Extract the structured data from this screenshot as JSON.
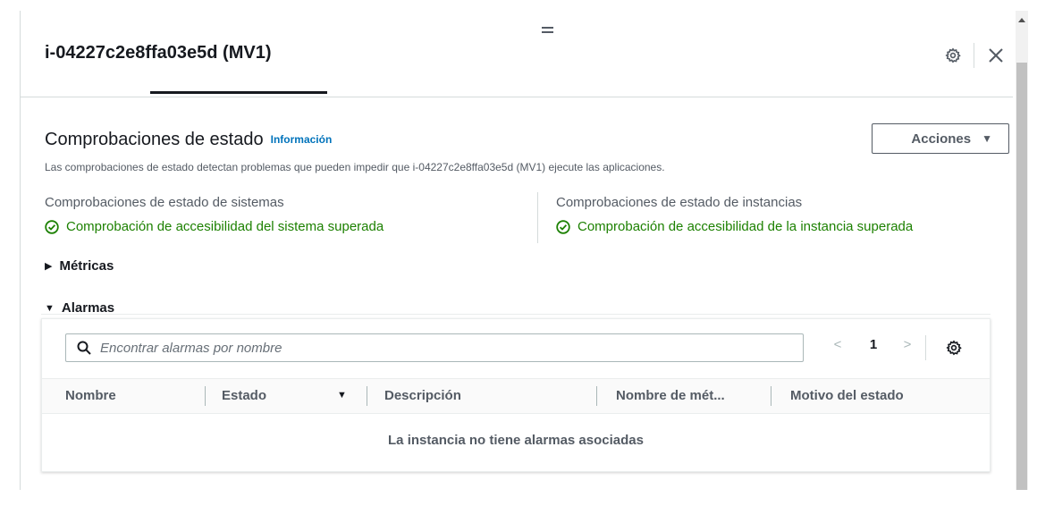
{
  "panel": {
    "title": "i-04227c2e8ffa03e5d (MV1)",
    "icons": {
      "settings": "gear-icon",
      "close": "close-icon",
      "drag": "drag-handle-icon"
    }
  },
  "status_checks": {
    "title": "Comprobaciones de estado",
    "info_link": "Información",
    "description": "Las comprobaciones de estado detectan problemas que pueden impedir que i-04227c2e8ffa03e5d (MV1) ejecute las aplicaciones.",
    "actions_button": "Acciones",
    "system": {
      "label": "Comprobaciones de estado de sistemas",
      "status": "Comprobación de accesibilidad del sistema superada"
    },
    "instance": {
      "label": "Comprobaciones de estado de instancias",
      "status": "Comprobación de accesibilidad de la instancia superada"
    },
    "status_color": "#1d8102"
  },
  "metrics": {
    "label": "Métricas",
    "expanded": false
  },
  "alarms": {
    "label": "Alarmas",
    "expanded": true,
    "search_placeholder": "Encontrar alarmas por nombre",
    "search_value": "",
    "pagination": {
      "prev": "<",
      "page": "1",
      "next": ">"
    },
    "columns": [
      "Nombre",
      "Estado",
      "Descripción",
      "Nombre de mét...",
      "Motivo del estado"
    ],
    "empty_message": "La instancia no tiene alarmas asociadas"
  },
  "colors": {
    "link": "#0073bb",
    "text": "#16191f",
    "muted": "#545b64"
  }
}
